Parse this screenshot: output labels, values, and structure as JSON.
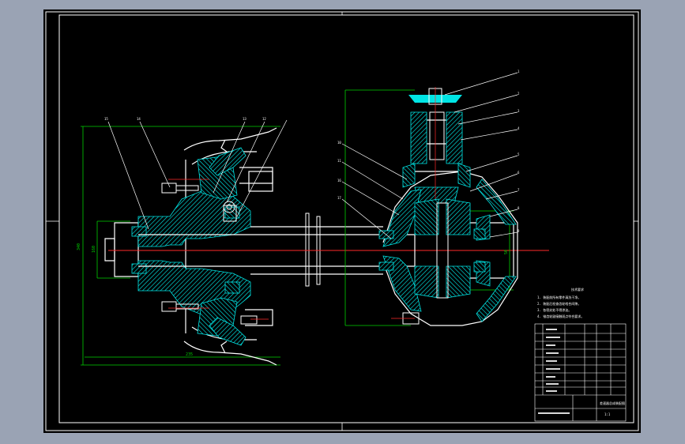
{
  "drawing": {
    "title_block": {
      "name": "差速器总成装配图",
      "scale": "1:1"
    },
    "tech_requirements": {
      "heading": "技术要求",
      "lines": [
        "1. 装配前所有零件清洗干净。",
        "2. 装配后检查齿轮啮合间隙。",
        "3. 各密封处不得渗油。",
        "4. 锥齿轮副接触斑点符合要求。"
      ]
    },
    "dimensions": {
      "left_height": "340",
      "left_inner": "160",
      "left_width": "235",
      "right_small": "50"
    },
    "leader_numbers_left": [
      "15",
      "14",
      "13",
      "12"
    ],
    "leader_numbers_right": [
      "1",
      "2",
      "3",
      "4",
      "5",
      "6",
      "7",
      "8",
      "9",
      "10",
      "11",
      "16",
      "17",
      "18"
    ]
  }
}
